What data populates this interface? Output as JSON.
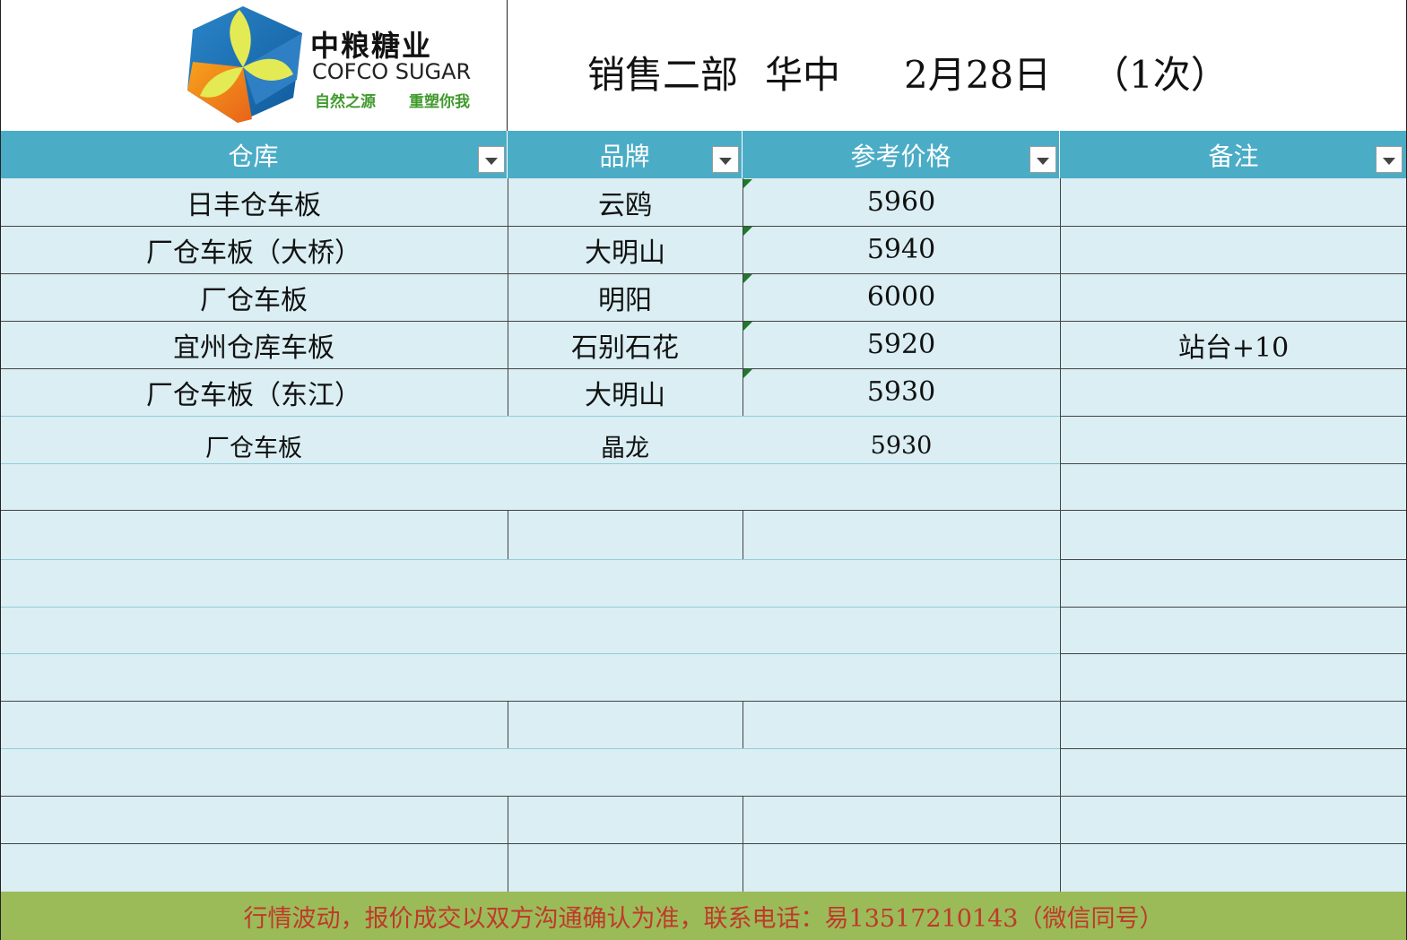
{
  "logo": {
    "name_cn": "中粮糖业",
    "name_en": "COFCO SUGAR",
    "tagline_left": "自然之源",
    "tagline_right": "重塑你我",
    "colors": {
      "blue": "#1f6fb6",
      "green": "#5cb030",
      "orange": "#ef7f1a",
      "yellow": "#cfe24a"
    }
  },
  "title": {
    "department": "销售二部",
    "region": "华中",
    "date": "2月28日",
    "edition": "（1次）"
  },
  "columns": [
    {
      "label": "仓库"
    },
    {
      "label": "品牌"
    },
    {
      "label": "参考价格"
    },
    {
      "label": "备注"
    }
  ],
  "rows": [
    {
      "warehouse": "日丰仓车板",
      "brand": "云鸥",
      "price": "5960",
      "note": ""
    },
    {
      "warehouse": "厂仓车板（大桥）",
      "brand": "大明山",
      "price": "5940",
      "note": ""
    },
    {
      "warehouse": "厂仓车板",
      "brand": "明阳",
      "price": "6000",
      "note": ""
    },
    {
      "warehouse": "宜州仓库车板",
      "brand": "石别石花",
      "price": "5920",
      "note": "站台+10"
    },
    {
      "warehouse": "厂仓车板（东江）",
      "brand": "大明山",
      "price": "5930",
      "note": ""
    },
    {
      "warehouse": "厂仓车板",
      "brand": "晶龙",
      "price": "5930",
      "note": ""
    }
  ],
  "footer": {
    "notice": "行情波动，报价成交以双方沟通确认为准，联系电话：易13517210143（微信同号）"
  },
  "colors": {
    "header_bg": "#4bacc6",
    "body_bg": "#daeef3",
    "footer_bg": "#9bbb59",
    "footer_text": "#c0392b"
  }
}
